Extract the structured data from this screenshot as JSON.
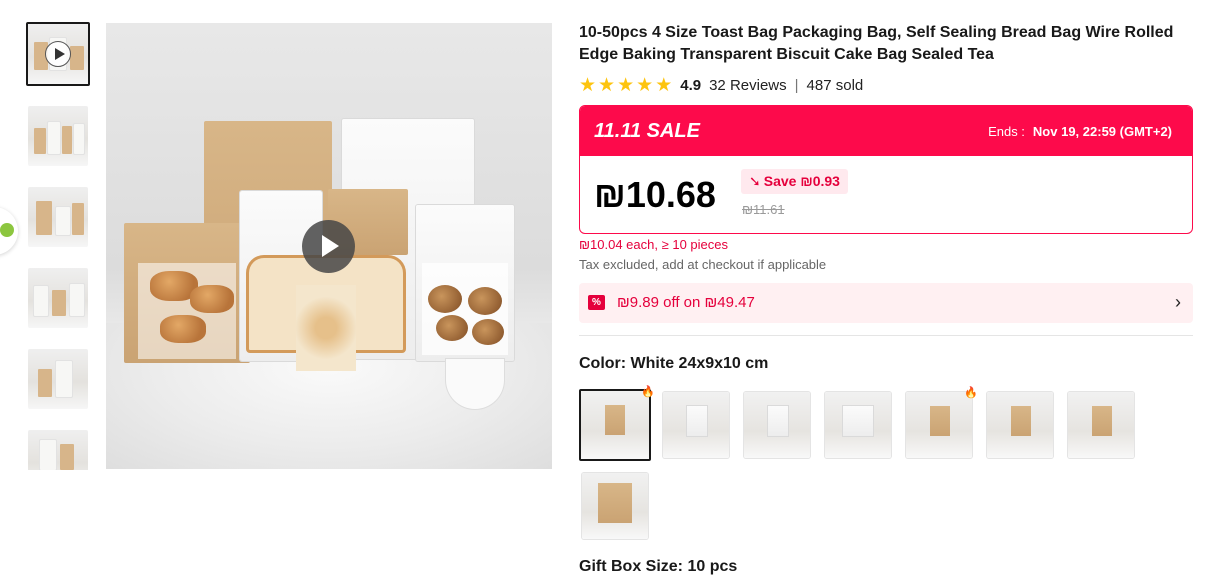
{
  "gallery": {
    "thumbnails": [
      {
        "kind": "video"
      },
      {
        "kind": "image"
      },
      {
        "kind": "image"
      },
      {
        "kind": "image"
      },
      {
        "kind": "image"
      },
      {
        "kind": "image"
      }
    ],
    "main_play_icon": "play-icon"
  },
  "product": {
    "title": "10-50pcs 4 Size Toast Bag Packaging Bag, Self Sealing Bread Bag Wire Rolled Edge Baking Transparent Biscuit Cake Bag Sealed Tea",
    "rating": "4.9",
    "stars": 5,
    "reviews": "32 Reviews",
    "separator": "|",
    "sold": "487 sold"
  },
  "sale": {
    "label": "11.11 SALE",
    "ends_label": "Ends :",
    "ends_value": "Nov 19, 22:59 (GMT+2)",
    "price": "₪10.68",
    "save": "Save ₪0.93",
    "original_price": "₪11.61",
    "accent_color": "#fd0a4b"
  },
  "pricing_notes": {
    "tier": "₪10.04 each, ≥ 10 pieces",
    "tax": "Tax excluded, add at checkout if applicable"
  },
  "coupon": {
    "icon": "percent-coupon-icon",
    "icon_glyph": "%",
    "text": "₪9.89 off on ₪49.47",
    "chevron": "›"
  },
  "color": {
    "label": "Color: White 24x9x10 cm",
    "options_count": 8,
    "selected_index": 0,
    "hot_indices": [
      0,
      4
    ]
  },
  "gift_box": {
    "label": "Gift Box Size: 10 pcs"
  }
}
